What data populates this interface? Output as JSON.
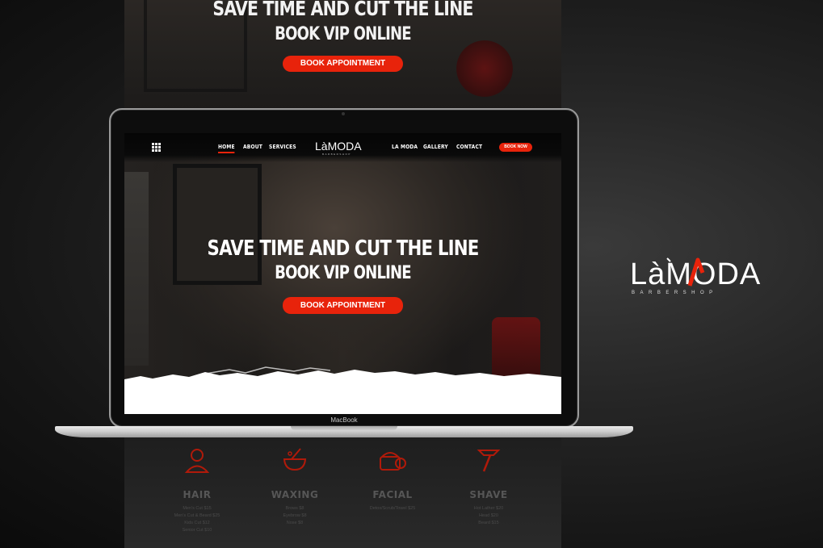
{
  "hero": {
    "headline": "SAVE TIME AND CUT THE LINE",
    "subheadline": "BOOK VIP ONLINE",
    "cta_label": "BOOK APPOINTMENT"
  },
  "nav": {
    "left_links": [
      "HOME",
      "ABOUT",
      "SERVICES"
    ],
    "right_links": [
      "LA MODA",
      "GALLERY",
      "CONTACT"
    ],
    "book_label": "BOOK NOW",
    "active": "HOME"
  },
  "logo": {
    "main": "LàMODA",
    "tagline": "BARBERSHOP"
  },
  "device": {
    "label": "MacBook"
  },
  "services": [
    {
      "name": "HAIR",
      "icon": "person-icon",
      "lines": [
        "Men's Cut $15",
        "Men's Cut & Beard $25",
        "Kids Cut $12",
        "Senior Cut $10"
      ]
    },
    {
      "name": "WAXING",
      "icon": "wax-bowl-icon",
      "lines": [
        "Brows $8",
        "Eyebrow $8",
        "Nose $8"
      ]
    },
    {
      "name": "FACIAL",
      "icon": "cream-jar-icon",
      "lines": [
        "Detox/Scrub/Towel $25"
      ]
    },
    {
      "name": "SHAVE",
      "icon": "razor-icon",
      "lines": [
        "Hot Lather $20",
        "Head $20",
        "Beard $15"
      ]
    }
  ],
  "colors": {
    "accent": "#e8230b",
    "background": "#1a1a1a"
  }
}
